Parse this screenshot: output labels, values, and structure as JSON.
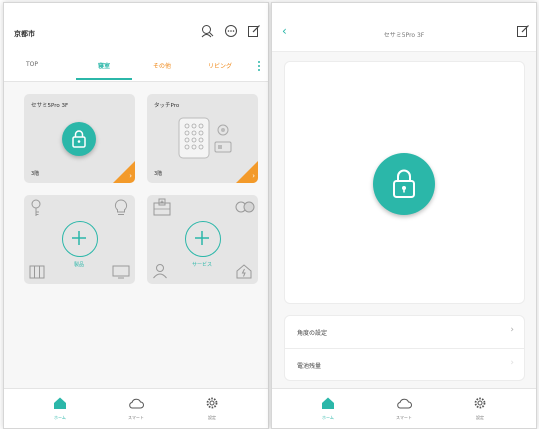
{
  "left_screen": {
    "header": {
      "city": "京都市"
    },
    "tabs": [
      {
        "label": "TOP",
        "state": "normal"
      },
      {
        "label": "寝室",
        "state": "active"
      },
      {
        "label": "その他",
        "state": "orange"
      },
      {
        "label": "リビング",
        "state": "orange"
      }
    ],
    "cards": {
      "sesame": {
        "title": "セサミ5Pro 3F",
        "sub": "3階"
      },
      "touch": {
        "title": "タッチPro",
        "sub": "3階"
      },
      "add_product": {
        "label": "製品"
      },
      "add_service": {
        "label": "サービス"
      }
    },
    "bottom_nav": [
      {
        "label": "ホーム",
        "icon": "home-icon",
        "active": true
      },
      {
        "label": "スマート",
        "icon": "cloud-icon",
        "active": false
      },
      {
        "label": "設定",
        "icon": "gear-icon",
        "active": false
      }
    ]
  },
  "right_screen": {
    "header": {
      "title": "セサミ5Pro 3F"
    },
    "settings": [
      {
        "label": "角度の設定"
      },
      {
        "label": "電池残量"
      }
    ],
    "bottom_nav": [
      {
        "label": "ホーム",
        "icon": "home-icon",
        "active": true
      },
      {
        "label": "スマート",
        "icon": "cloud-icon",
        "active": false
      },
      {
        "label": "設定",
        "icon": "gear-icon",
        "active": false
      }
    ]
  },
  "colors": {
    "accent": "#2bb7a9",
    "orange": "#f39a2a"
  }
}
